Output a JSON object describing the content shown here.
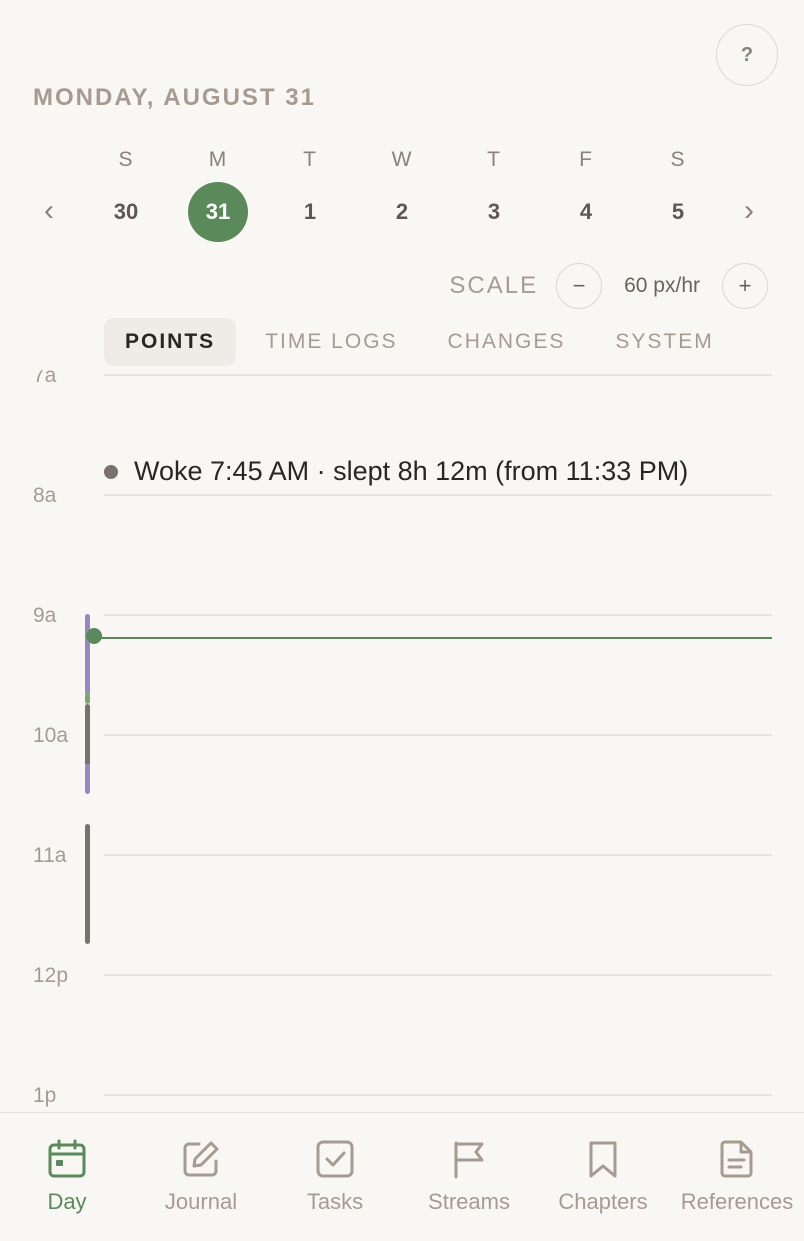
{
  "help": {
    "label": "?"
  },
  "date_heading": "MONDAY, AUGUST 31",
  "week": {
    "prev": "‹",
    "next": "›",
    "days": [
      {
        "dow": "S",
        "num": "30"
      },
      {
        "dow": "M",
        "num": "31",
        "selected": true
      },
      {
        "dow": "T",
        "num": "1"
      },
      {
        "dow": "W",
        "num": "2"
      },
      {
        "dow": "T",
        "num": "3"
      },
      {
        "dow": "F",
        "num": "4"
      },
      {
        "dow": "S",
        "num": "5"
      }
    ]
  },
  "scale": {
    "label": "SCALE",
    "minus": "−",
    "value": "60 px/hr",
    "plus": "+"
  },
  "tabs": [
    "POINTS",
    "TIME LOGS",
    "CHANGES",
    "SYSTEM"
  ],
  "active_tab": "POINTS",
  "timeline": {
    "hours": [
      "7a",
      "8a",
      "9a",
      "10a",
      "11a",
      "12p",
      "1p"
    ],
    "event": "Woke 7:45 AM · slept 8h 12m (from 11:33 PM)"
  },
  "colors": {
    "accent": "#5a8a5a",
    "purple_bar": "#9a86c4",
    "gray_bar": "#7a716a"
  },
  "nav": [
    {
      "label": "Day",
      "icon": "calendar-icon",
      "active": true
    },
    {
      "label": "Journal",
      "icon": "edit-icon"
    },
    {
      "label": "Tasks",
      "icon": "checkbox-icon"
    },
    {
      "label": "Streams",
      "icon": "flag-icon"
    },
    {
      "label": "Chapters",
      "icon": "bookmark-icon"
    },
    {
      "label": "References",
      "icon": "document-icon"
    }
  ]
}
